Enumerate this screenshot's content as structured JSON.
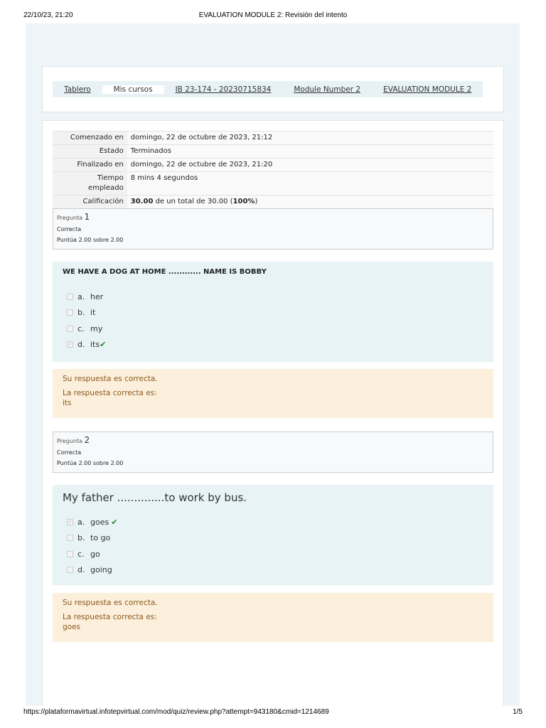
{
  "header": {
    "datetime": "22/10/23, 21:20",
    "title": "EVALUATION MODULE 2: Revisión del intento"
  },
  "footer": {
    "url": "https://plataformavirtual.infotepvirtual.com/mod/quiz/review.php?attempt=943180&cmid=1214689",
    "page": "1/5"
  },
  "breadcrumb": [
    "Tablero",
    "Mis cursos",
    "IB 23-174 - 20230715834",
    "Module Number 2",
    "EVALUATION MODULE 2"
  ],
  "summary": [
    {
      "k": "Comenzado en",
      "v": "domingo, 22 de octubre de 2023, 21:12"
    },
    {
      "k": "Estado",
      "v": "Terminados"
    },
    {
      "k": "Finalizado en",
      "v": "domingo, 22 de octubre de 2023, 21:20"
    },
    {
      "k": "Tiempo empleado",
      "v": "8 mins 4 segundos"
    },
    {
      "k": "Calificación",
      "v_bold": "30.00",
      "v": " de un total de 30.00 (",
      "v_pct": "100%",
      "v_end": ")"
    }
  ],
  "questions": [
    {
      "label": "Pregunta",
      "num": "1",
      "state": "Correcta",
      "score": "Puntúa 2.00 sobre 2.00",
      "text": "WE HAVE A DOG AT HOME ............ NAME IS BOBBY",
      "options": [
        {
          "l": "a.",
          "t": "her"
        },
        {
          "l": "b.",
          "t": "it"
        },
        {
          "l": "c.",
          "t": "my"
        },
        {
          "l": "d.",
          "t": "its"
        }
      ],
      "feedback": "Su respuesta es correcta.",
      "correct_label": "La respuesta correcta es:",
      "correct": "its"
    },
    {
      "label": "Pregunta",
      "num": "2",
      "state": "Correcta",
      "score": "Puntúa 2.00 sobre 2.00",
      "text": "My father ..............to work by bus.",
      "options": [
        {
          "l": "a.",
          "t": "goes"
        },
        {
          "l": "b.",
          "t": "to go"
        },
        {
          "l": "c.",
          "t": "go"
        },
        {
          "l": "d.",
          "t": "going"
        }
      ],
      "feedback": "Su respuesta es correcta.",
      "correct_label": "La respuesta correcta es:",
      "correct": "goes"
    }
  ],
  "check": "✔"
}
